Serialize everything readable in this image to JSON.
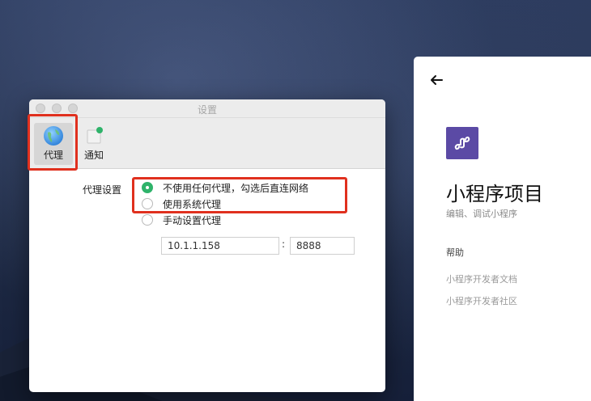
{
  "settings_window": {
    "title": "设置",
    "toolbar": {
      "proxy_label": "代理",
      "notify_label": "通知"
    },
    "proxy_settings": {
      "label": "代理设置",
      "options": [
        {
          "label": "不使用任何代理，勾选后直连网络",
          "checked": true
        },
        {
          "label": "使用系统代理",
          "checked": false
        },
        {
          "label": "手动设置代理",
          "checked": false
        }
      ],
      "host_value": "10.1.1.158",
      "separator": ":",
      "port_value": "8888"
    }
  },
  "mini_program_panel": {
    "title": "小程序项目",
    "subtitle": "编辑、调试小程序",
    "help_heading": "帮助",
    "links": [
      "小程序开发者文档",
      "小程序开发者社区"
    ]
  },
  "colors": {
    "accent_green": "#2fb36a",
    "highlight_red": "#e0301e",
    "logo_purple": "#5b4aa5"
  }
}
